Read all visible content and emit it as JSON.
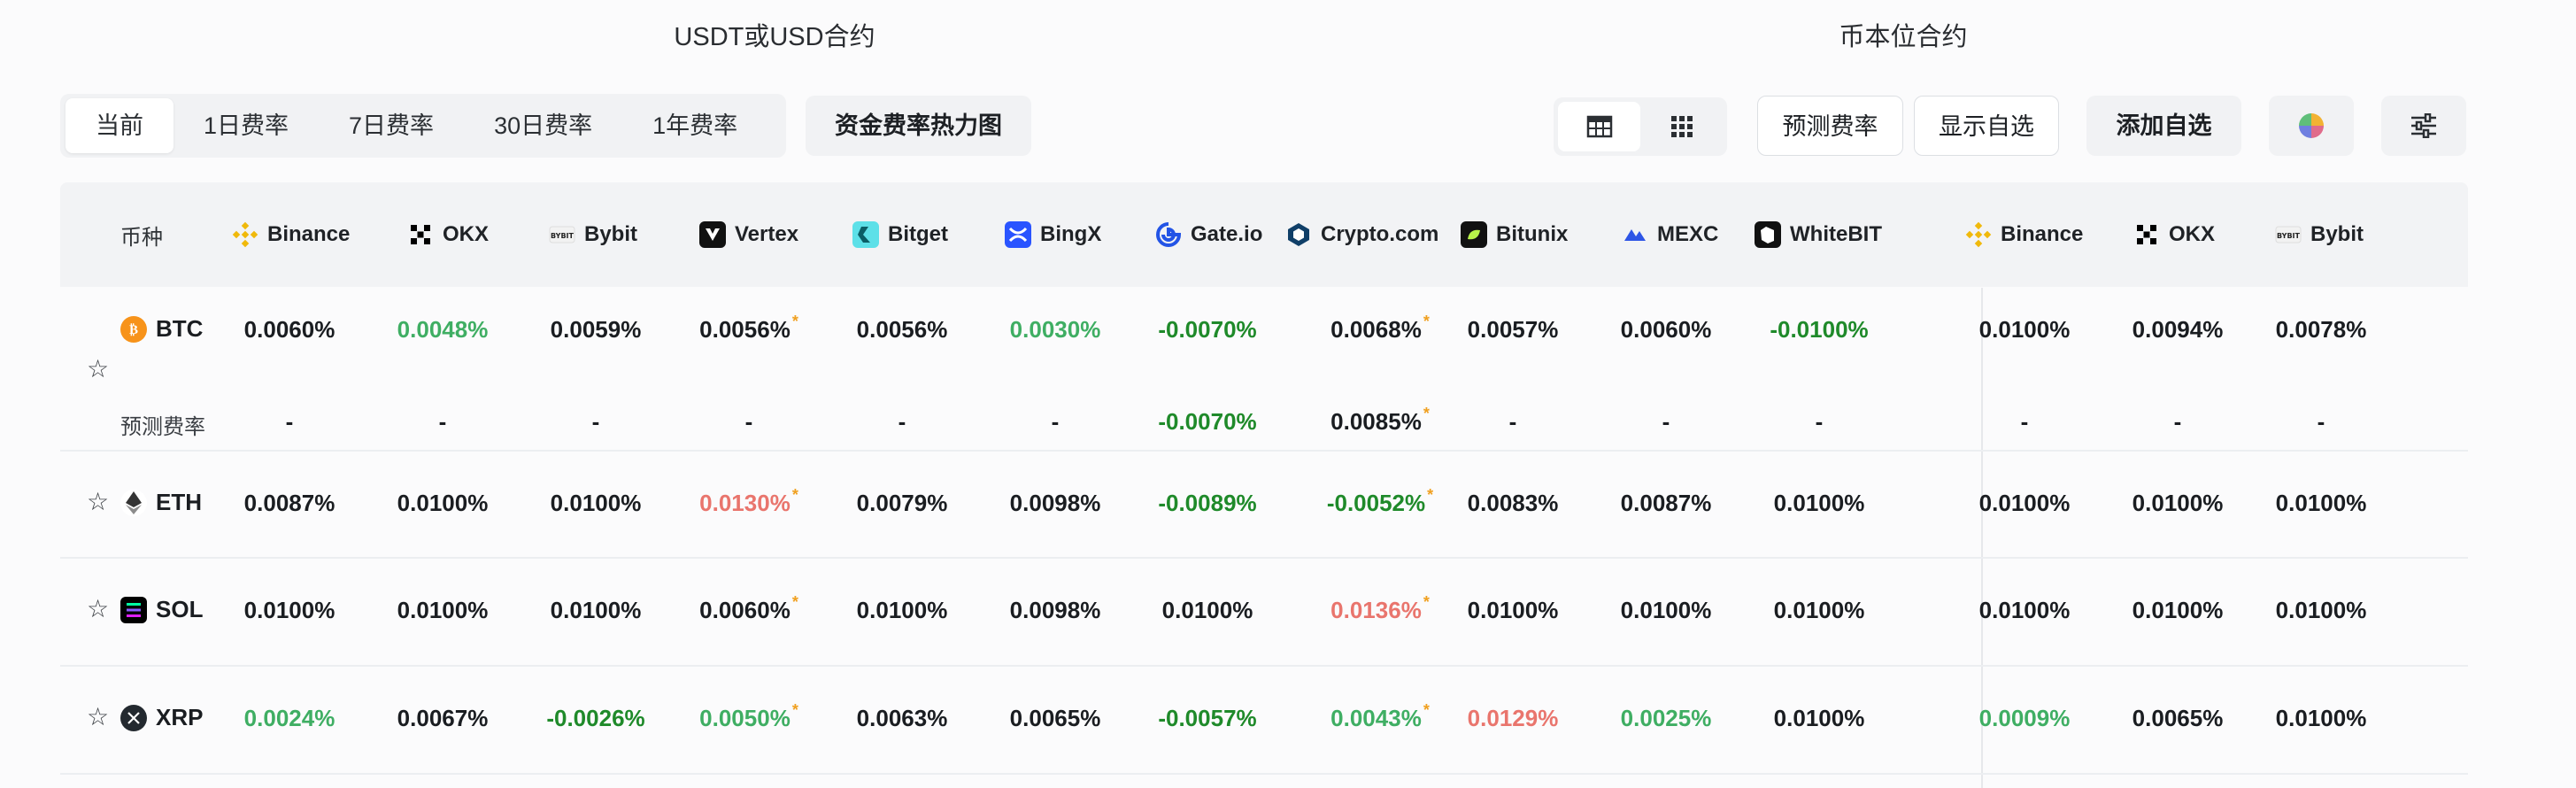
{
  "titles": {
    "usdt": "USDT或USD合约",
    "coin": "币本位合约"
  },
  "periods": [
    "当前",
    "1日费率",
    "7日费率",
    "30日费率",
    "1年费率"
  ],
  "active_period": "当前",
  "heatmap_label": "资金费率热力图",
  "predict_label": "预测费率",
  "show_fav_label": "显示自选",
  "add_fav_label": "添加自选",
  "table": {
    "coin_header": "币种",
    "predict_row_label": "预测费率",
    "exchanges": [
      {
        "name": "Binance",
        "icon": "binance-icon",
        "color": "#f0b90b"
      },
      {
        "name": "OKX",
        "icon": "okx-icon",
        "color": "#000000"
      },
      {
        "name": "Bybit",
        "icon": "bybit-icon",
        "color": "#333333"
      },
      {
        "name": "Vertex",
        "icon": "vertex-icon",
        "color": "#111111"
      },
      {
        "name": "Bitget",
        "icon": "bitget-icon",
        "color": "#1da2b4"
      },
      {
        "name": "BingX",
        "icon": "bingx-icon",
        "color": "#2a54ff"
      },
      {
        "name": "Gate.io",
        "icon": "gate-icon",
        "color": "#2354e6"
      },
      {
        "name": "Crypto.com",
        "icon": "cryptocom-icon",
        "color": "#103f68"
      },
      {
        "name": "Bitunix",
        "icon": "bitunix-icon",
        "color": "#b7f34a"
      },
      {
        "name": "MEXC",
        "icon": "mexc-icon",
        "color": "#2e55e6"
      },
      {
        "name": "WhiteBIT",
        "icon": "whitebit-icon",
        "color": "#111111"
      },
      {
        "name": "Binance",
        "icon": "binance-icon",
        "color": "#f0b90b"
      },
      {
        "name": "OKX",
        "icon": "okx-icon",
        "color": "#000000"
      },
      {
        "name": "Bybit",
        "icon": "bybit-icon",
        "color": "#333333"
      }
    ],
    "rows": [
      {
        "coin": "BTC",
        "icon": "btc-icon",
        "color": "#f7931a",
        "values": [
          "0.0060%",
          "0.0048%",
          "0.0059%",
          "0.0056%",
          "0.0056%",
          "0.0030%",
          "-0.0070%",
          "0.0068%",
          "0.0057%",
          "0.0060%",
          "-0.0100%",
          "0.0100%",
          "0.0094%",
          "0.0078%"
        ],
        "styles": [
          "",
          "green",
          "",
          "",
          "",
          "green",
          "neg",
          "",
          "",
          "",
          "neg",
          "",
          "",
          ""
        ],
        "asterisk": [
          false,
          false,
          false,
          true,
          false,
          false,
          false,
          true,
          false,
          false,
          false,
          false,
          false,
          false
        ],
        "predict": [
          "-",
          "-",
          "-",
          "-",
          "-",
          "-",
          "-0.0070%",
          "0.0085%",
          "-",
          "-",
          "-",
          "-",
          "-",
          "-"
        ],
        "predict_styles": [
          "",
          "",
          "",
          "",
          "",
          "",
          "neg",
          "",
          "",
          "",
          "",
          "",
          "",
          ""
        ],
        "predict_asterisk": [
          false,
          false,
          false,
          false,
          false,
          false,
          false,
          true,
          false,
          false,
          false,
          false,
          false,
          false
        ]
      },
      {
        "coin": "ETH",
        "icon": "eth-icon",
        "color": "#627eea",
        "values": [
          "0.0087%",
          "0.0100%",
          "0.0100%",
          "0.0130%",
          "0.0079%",
          "0.0098%",
          "-0.0089%",
          "-0.0052%",
          "0.0083%",
          "0.0087%",
          "0.0100%",
          "0.0100%",
          "0.0100%",
          "0.0100%"
        ],
        "styles": [
          "",
          "",
          "",
          "red",
          "",
          "",
          "neg",
          "neg",
          "",
          "",
          "",
          "",
          "",
          ""
        ],
        "asterisk": [
          false,
          false,
          false,
          true,
          false,
          false,
          false,
          true,
          false,
          false,
          false,
          false,
          false,
          false
        ]
      },
      {
        "coin": "SOL",
        "icon": "sol-icon",
        "color": "#000000",
        "values": [
          "0.0100%",
          "0.0100%",
          "0.0100%",
          "0.0060%",
          "0.0100%",
          "0.0098%",
          "0.0100%",
          "0.0136%",
          "0.0100%",
          "0.0100%",
          "0.0100%",
          "0.0100%",
          "0.0100%",
          "0.0100%"
        ],
        "styles": [
          "",
          "",
          "",
          "",
          "",
          "",
          "",
          "red",
          "",
          "",
          "",
          "",
          "",
          ""
        ],
        "asterisk": [
          false,
          false,
          false,
          true,
          false,
          false,
          false,
          true,
          false,
          false,
          false,
          false,
          false,
          false
        ]
      },
      {
        "coin": "XRP",
        "icon": "xrp-icon",
        "color": "#23292f",
        "values": [
          "0.0024%",
          "0.0067%",
          "-0.0026%",
          "0.0050%",
          "0.0063%",
          "0.0065%",
          "-0.0057%",
          "0.0043%",
          "0.0129%",
          "0.0025%",
          "0.0100%",
          "0.0009%",
          "0.0065%",
          "0.0100%"
        ],
        "styles": [
          "green",
          "",
          "neg",
          "green",
          "",
          "",
          "neg",
          "green",
          "red",
          "green",
          "",
          "green",
          "",
          ""
        ],
        "asterisk": [
          false,
          false,
          false,
          true,
          false,
          false,
          false,
          true,
          false,
          false,
          false,
          false,
          false,
          false
        ]
      }
    ]
  }
}
